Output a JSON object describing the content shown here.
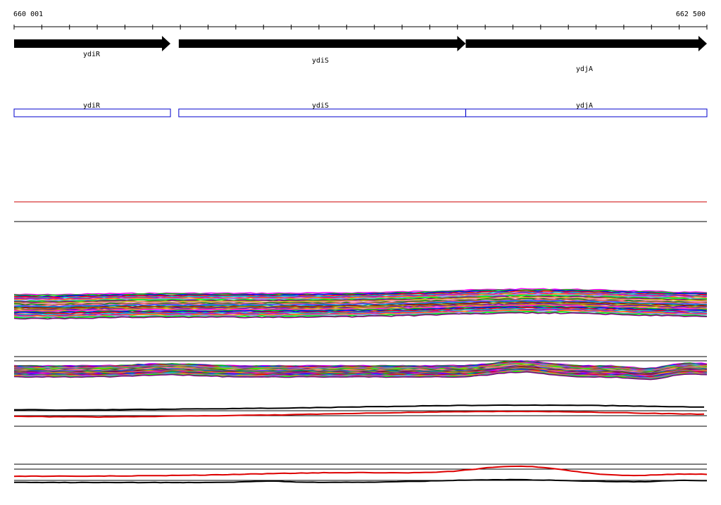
{
  "ruler": {
    "start_label": "660 001",
    "end_label": "662 500",
    "start": 660001,
    "end": 662500
  },
  "colors": {
    "arrow": "#000000",
    "gene_box": "#0000cc",
    "red_line": "#cc0000",
    "axis": "#000000"
  },
  "genes": [
    {
      "name": "ydiR",
      "start": 660001,
      "end": 660565,
      "strand": "+"
    },
    {
      "name": "ydiS",
      "start": 660595,
      "end": 661630,
      "strand": "+"
    },
    {
      "name": "ydjA",
      "start": 661630,
      "end": 662500,
      "strand": "+"
    }
  ],
  "track_palette": [
    "#ff00ff",
    "#00c000",
    "#0000ff",
    "#ff0000",
    "#00c0c0",
    "#c000c0",
    "#ff8000",
    "#8080ff",
    "#00ff00",
    "#800080",
    "#c0c000",
    "#ff80c0",
    "#008000",
    "#ff6060",
    "#4040ff",
    "#00a0a0",
    "#a00000",
    "#a0a000",
    "#6000c0",
    "#e0a000"
  ],
  "profile_tracks": [
    {
      "series_count": 30
    },
    {
      "series_count": 30
    }
  ]
}
